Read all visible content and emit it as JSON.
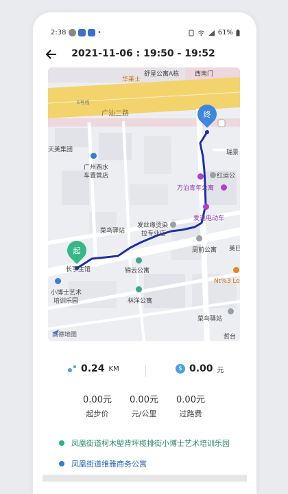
{
  "status_bar": {
    "time": "2:38",
    "battery": "61%"
  },
  "header": {
    "title": "2021-11-06 : 19:50 - 19:52"
  },
  "map": {
    "start_label": "起",
    "end_label": "终",
    "labels": {
      "huachuang": "华莱士",
      "shuchenggongyu": "舒呈公寓A栋",
      "xinanmen": "西南门",
      "guangshan_road": "广汕二路",
      "route_num": "6号线",
      "tianmei": "天美集团",
      "guangzhou_xishui": "广州西水",
      "chezhi": "车置营店",
      "hongyuangong": "红运公",
      "ruijing": "瑞景",
      "wanbo": "万泊青年公寓",
      "aixin": "爱迅电动车",
      "cainiao1": "菜鸟驿站",
      "fada": "发丝缘烫染",
      "laguan": "拉专业店",
      "zhouqian": "周前公寓",
      "meiqi": "美巳",
      "changsheng": "长亨生馆",
      "jinyun": "锦云公寓",
      "nt3": "Nt%3 Le",
      "xiaoboshi1": "小博士艺术",
      "xiaoboshi2": "培训乐园",
      "linyang": "林洋公寓",
      "cainiao2": "菜鸟驿站",
      "zhetai": "哲台",
      "watermark": "高德地图"
    }
  },
  "stats": {
    "distance_value": "0.24",
    "distance_unit": "KM",
    "cost_value": "0.00",
    "cost_unit": "元",
    "coin_symbol": "$",
    "base_fare_value": "0.00元",
    "base_fare_label": "起步价",
    "per_km_value": "0.00元",
    "per_km_label": "元/公里",
    "toll_value": "0.00元",
    "toll_label": "过路费"
  },
  "addresses": {
    "start": "凤凰街道柯木塱背坪榄排街小博士艺术培训乐园",
    "end": "凤凰街道维雅商务公寓"
  },
  "colors": {
    "route": "#1b2fa8",
    "start_pin": "#35b78a",
    "end_pin": "#3d87de",
    "start_dot": "#1fb48a",
    "end_dot": "#2f7fd8",
    "start_text": "#2a8a68",
    "end_text": "#2766b8",
    "main_road": "#f3d36c"
  }
}
